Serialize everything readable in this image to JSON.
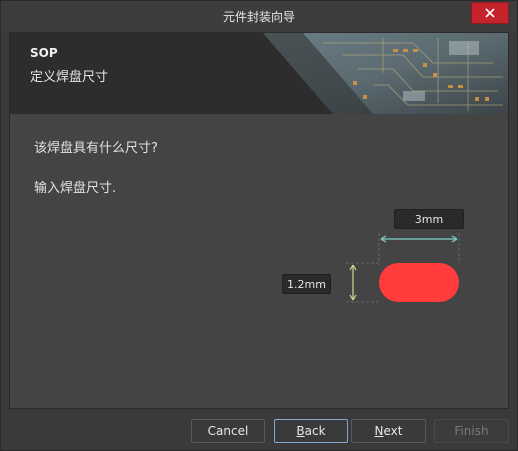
{
  "window": {
    "title": "元件封装向导"
  },
  "banner": {
    "title": "SOP",
    "subtitle": "定义焊盘尺寸"
  },
  "content": {
    "question": "该焊盘具有什么尺寸?",
    "instruction": "输入焊盘尺寸."
  },
  "pad": {
    "width_label": "3mm",
    "height_label": "1.2mm",
    "color": "#ff3b3b",
    "width_dim_color": "#7fd0c8",
    "height_dim_color": "#d8d890"
  },
  "buttons": {
    "cancel": "Cancel",
    "back_first": "B",
    "back_rest": "ack",
    "next_first": "N",
    "next_rest": "ext",
    "finish": "Finish"
  },
  "icons": {
    "close": "close-icon",
    "banner": "pcb-board-image"
  }
}
